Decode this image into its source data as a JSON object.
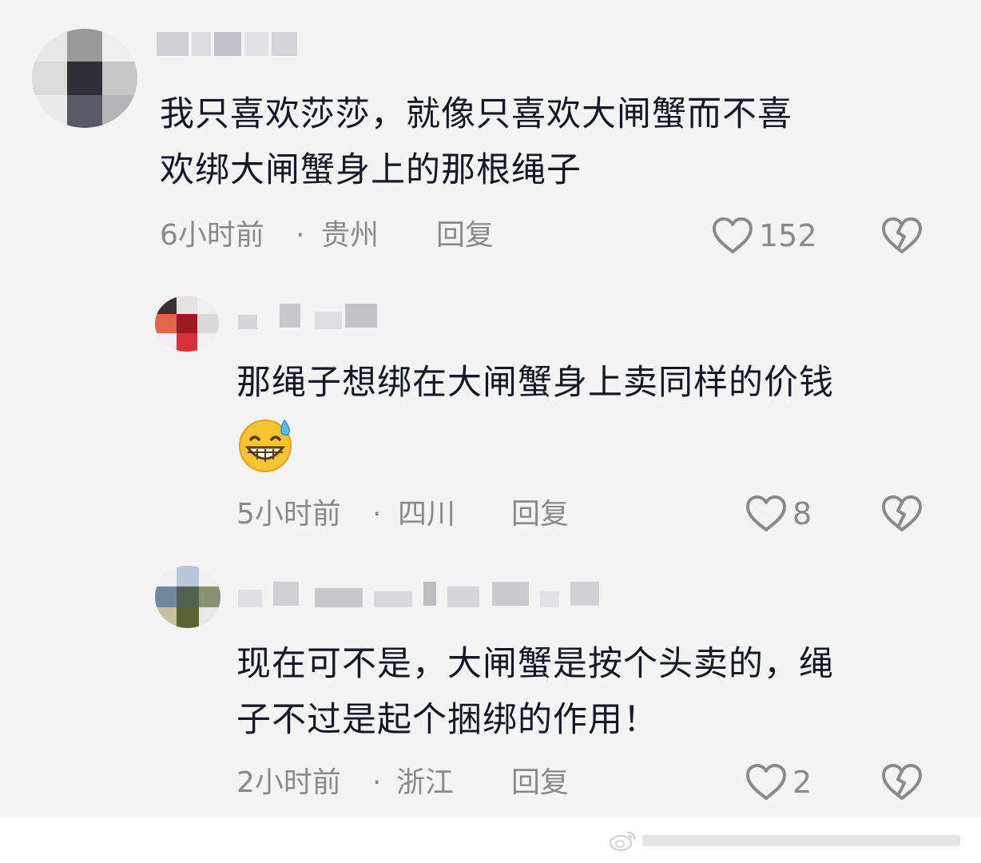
{
  "comments": [
    {
      "text_lines": [
        "我只喜欢莎莎，就像只喜欢大闸蟹而不喜",
        "欢绑大闸蟹身上的那根绳子"
      ],
      "time": "6小时前",
      "sep": "·",
      "location": "贵州",
      "reply_label": "回复",
      "likes": "152"
    },
    {
      "text_lines": [
        "那绳子想绑在大闸蟹身上卖同样的价钱"
      ],
      "emoji": "grinning-sweat-emoji",
      "time": "5小时前",
      "sep": "·",
      "location": "四川",
      "reply_label": "回复",
      "likes": "8"
    },
    {
      "text_lines": [
        "现在可不是，大闸蟹是按个头卖的，绳",
        "子不过是起个捆绑的作用！"
      ],
      "time": "2小时前",
      "sep": "·",
      "location": "浙江",
      "reply_label": "回复",
      "likes": "2"
    }
  ],
  "icons": {
    "like": "heart-outline-icon",
    "dislike": "broken-heart-icon",
    "watermark": "weibo-logo-icon"
  },
  "colors": {
    "text": "#161823",
    "meta": "#8a8a8a",
    "background": "#f4f4f4"
  }
}
